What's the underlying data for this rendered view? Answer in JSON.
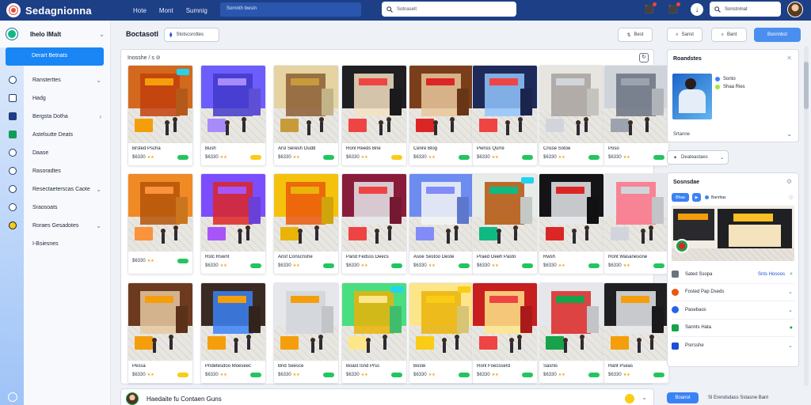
{
  "app": {
    "title": "Sedagnionna",
    "brand_color": "#1d3f86",
    "accent_color": "#1a86f5"
  },
  "topnav": [
    "Hote",
    "Mont",
    "Sumnig"
  ],
  "top_search": {
    "placeholder": "Sornnth bwsin"
  },
  "search": {
    "value": "Sotnaselt"
  },
  "user_search": {
    "value": "Sonstnmat"
  },
  "sidebar": {
    "header": "Ihelo IMalt",
    "active": "Derart Betnats",
    "items": [
      {
        "label": "Ransterttes",
        "icon": "grid-icon",
        "chevron": "⌄"
      },
      {
        "label": "Hadg",
        "icon": "list-icon",
        "chevron": ""
      },
      {
        "label": "Bergsta Dotha",
        "icon": "folder-icon",
        "chevron": "›"
      },
      {
        "label": "Astelsutte Deats",
        "icon": "store-icon",
        "chevron": ""
      },
      {
        "label": "Daase",
        "icon": "globe-icon",
        "chevron": ""
      },
      {
        "label": "Rasoradtes",
        "icon": "clock-icon",
        "chevron": ""
      },
      {
        "label": "Resectaeterscas Caote",
        "icon": "chat-icon",
        "chevron": "⌄"
      },
      {
        "label": "Sraosoats",
        "icon": "help-icon",
        "chevron": ""
      },
      {
        "label": "Roraes Gesadotes",
        "icon": "coin-icon",
        "chevron": "⌄"
      },
      {
        "label": "I-Bsiesnes",
        "icon": "",
        "chevron": ""
      }
    ]
  },
  "toolbar": {
    "title": "Boctasotl",
    "pill": "Stotscsrottes",
    "btn1": "Best",
    "btn2": "Sanst",
    "btn3": "Bant",
    "primary": "Bsnnnbst"
  },
  "grid": {
    "header": "Inosshe / s ⊘",
    "tiles": [
      {
        "name": "Brsted Pscha",
        "price": "$6330",
        "stars": "★★",
        "chip": "#22c55e",
        "wall": "#d2691e",
        "sign": "#f59e0b",
        "accent": "#c2410c",
        "tag": "#22d3ee"
      },
      {
        "name": "Bush",
        "price": "$6330",
        "stars": "★★",
        "chip": "#facc15",
        "wall": "#6d5dfc",
        "sign": "#a78bfa",
        "accent": "#4338ca",
        "tag": ""
      },
      {
        "name": "Arsl Seresh Oudd",
        "price": "$6330",
        "stars": "★★",
        "chip": "#22c55e",
        "wall": "#e5d3a1",
        "sign": "#c79a3b",
        "accent": "#8b5e34",
        "tag": ""
      },
      {
        "name": "Ronl Reeds Bne",
        "price": "$6330",
        "stars": "★★",
        "chip": "#facc15",
        "wall": "#1f1f22",
        "sign": "#ef4444",
        "accent": "#f3e2c2",
        "tag": ""
      },
      {
        "name": "Cenre Blog",
        "price": "$6330",
        "stars": "★★",
        "chip": "#22c55e",
        "wall": "#7a3e1b",
        "sign": "#dc2626",
        "accent": "#e7c79b",
        "tag": ""
      },
      {
        "name": "Pwnss Qurre",
        "price": "$6330",
        "stars": "★★",
        "chip": "#22c55e",
        "wall": "#1e2a5a",
        "sign": "#ef4444",
        "accent": "#93c5fd",
        "tag": ""
      },
      {
        "name": "Cnsse Sotoe",
        "price": "$6330",
        "stars": "★★",
        "chip": "#22c55e",
        "wall": "#e7e5e0",
        "sign": "#d1d5db",
        "accent": "#a8a29e",
        "tag": ""
      },
      {
        "name": "Poso",
        "price": "$6330",
        "stars": "★★",
        "chip": "#22c55e",
        "wall": "#cfd4da",
        "sign": "#9ca3af",
        "accent": "#6b7280",
        "tag": ""
      },
      {
        "name": "",
        "price": "$6330",
        "stars": "★★",
        "chip": "#22c55e",
        "wall": "#f08a24",
        "sign": "#fb923c",
        "accent": "#b45309",
        "tag": ""
      },
      {
        "name": "Rstc Rswnt",
        "price": "$6330",
        "stars": "★★",
        "chip": "#22c55e",
        "wall": "#7c4dff",
        "sign": "#a855f7",
        "accent": "#dc2626",
        "tag": ""
      },
      {
        "name": "Ansf Conscnshe",
        "price": "$6330",
        "stars": "★★",
        "chip": "#22c55e",
        "wall": "#f4c20d",
        "sign": "#eab308",
        "accent": "#ea580c",
        "tag": ""
      },
      {
        "name": "Pand Fedsss Deecs",
        "price": "$6330",
        "stars": "★★",
        "chip": "#22c55e",
        "wall": "#8a1c3b",
        "sign": "#ef4444",
        "accent": "#e5e7eb",
        "tag": ""
      },
      {
        "name": "Asoe Sestoo Deste",
        "price": "$6330",
        "stars": "★★",
        "chip": "#22c55e",
        "wall": "#6d8cf0",
        "sign": "#818cf8",
        "accent": "#f3f4f6",
        "tag": ""
      },
      {
        "name": "Praed Oeeh Pasto",
        "price": "$6330",
        "stars": "★★",
        "chip": "#22c55e",
        "wall": "#e7ece9",
        "sign": "#10b981",
        "accent": "#b45309",
        "tag": "#22d3ee"
      },
      {
        "name": "Rwsh",
        "price": "$6330",
        "stars": "★★",
        "chip": "#22c55e",
        "wall": "#141416",
        "sign": "#dc2626",
        "accent": "#e5e7eb",
        "tag": ""
      },
      {
        "name": "Ront Wasanesone",
        "price": "$6330",
        "stars": "★★",
        "chip": "#22c55e",
        "wall": "#e5e7eb",
        "sign": "#d1d5db",
        "accent": "#fb7185",
        "tag": ""
      },
      {
        "name": "Pessa",
        "price": "$6330",
        "stars": "★★",
        "chip": "#facc15",
        "wall": "#6b3a1f",
        "sign": "#f59e0b",
        "accent": "#e5c9a2",
        "tag": ""
      },
      {
        "name": "Pndetesdoo Moeseec",
        "price": "$6330",
        "stars": "★★",
        "chip": "#22c55e",
        "wall": "#3b2a22",
        "sign": "#f59e0b",
        "accent": "#3b82f6",
        "tag": ""
      },
      {
        "name": "Bnd Seesce",
        "price": "$6330",
        "stars": "★★",
        "chip": "#22c55e",
        "wall": "#e5e7eb",
        "sign": "#f59e0b",
        "accent": "#d1d5db",
        "tag": ""
      },
      {
        "name": "Boast Isnd Prss",
        "price": "$6330",
        "stars": "★★",
        "chip": "#22c55e",
        "wall": "#4ade80",
        "sign": "#fde68a",
        "accent": "#eab308",
        "tag": "#22d3ee"
      },
      {
        "name": "Boste",
        "price": "$6330",
        "stars": "★★",
        "chip": "#22c55e",
        "wall": "#fde68a",
        "sign": "#facc15",
        "accent": "#eab308",
        "tag": "#facc15"
      },
      {
        "name": "Ronl Foecsserd",
        "price": "$6330",
        "stars": "★★",
        "chip": "#22c55e",
        "wall": "#c81e1e",
        "sign": "#ef4444",
        "accent": "#fde68a",
        "tag": ""
      },
      {
        "name": "Sasnls",
        "price": "$6330",
        "stars": "★★",
        "chip": "#22c55e",
        "wall": "#e5e7eb",
        "sign": "#16a34a",
        "accent": "#dc2626",
        "tag": ""
      },
      {
        "name": "Hant Pseas",
        "price": "$6330",
        "stars": "★★",
        "chip": "#22c55e",
        "wall": "#1f1f22",
        "sign": "#f59e0b",
        "accent": "#e5e7eb",
        "tag": ""
      }
    ]
  },
  "bottom": {
    "text": "Haedaite fu Contaen Guns"
  },
  "right": {
    "card1": {
      "title": "Roandstes",
      "badge1": "Sonto",
      "badge2": "Shaa Ries",
      "foot": "Srtanne",
      "badge1_color": "#3b82f6",
      "badge2_color": "#a3e635"
    },
    "chip": "Deateastaes",
    "card2": {
      "title": "Sosnsdae",
      "pill1": "Bhaa",
      "pill2": "Banrttas",
      "list": [
        {
          "label": "Sated Ssopa",
          "mid": "Snts Hosoos",
          "icon_color": "#6b7280"
        },
        {
          "label": "Fosted Pap Dseds",
          "mid": "",
          "icon_color": "#ea580c"
        },
        {
          "label": "Pasebaos",
          "mid": "",
          "icon_color": "#2563eb"
        },
        {
          "label": "Sannts Hata",
          "mid": "",
          "icon_color": "#16a34a"
        },
        {
          "label": "Psrrsshe",
          "mid": "",
          "icon_color": "#1d4ed8"
        }
      ]
    },
    "bottom_btn": "Boanot",
    "bottom_text": "Sl Erendsdass Sstasne Bant"
  }
}
